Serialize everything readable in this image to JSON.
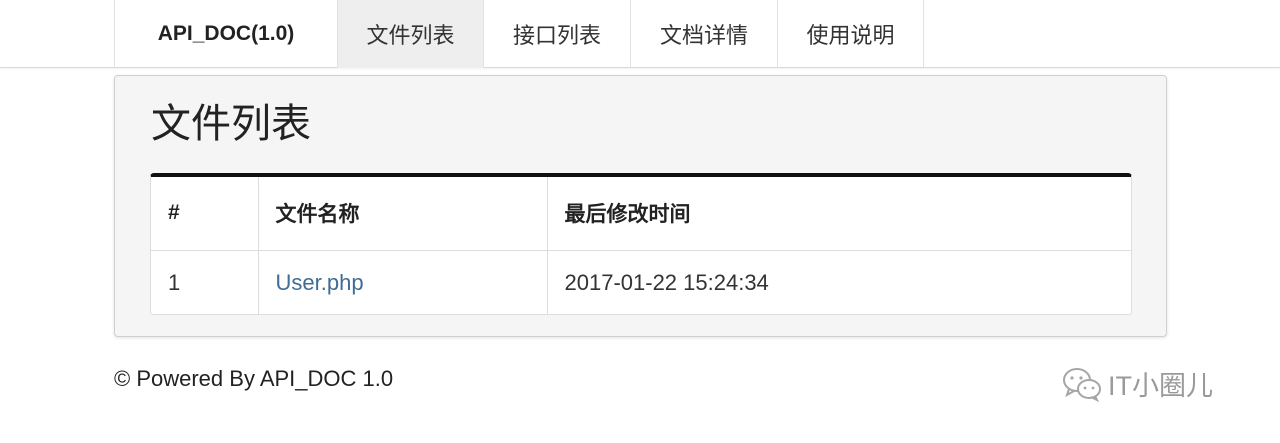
{
  "nav": {
    "brand": "API_DOC(1.0)",
    "items": [
      {
        "label": "文件列表",
        "active": true
      },
      {
        "label": "接口列表",
        "active": false
      },
      {
        "label": "文档详情",
        "active": false
      },
      {
        "label": "使用说明",
        "active": false
      }
    ]
  },
  "main": {
    "title": "文件列表",
    "table": {
      "headers": [
        "#",
        "文件名称",
        "最后修改时间"
      ],
      "rows": [
        {
          "index": "1",
          "filename": "User.php",
          "modified": "2017-01-22 15:24:34"
        }
      ]
    }
  },
  "footer": {
    "text": "© Powered By API_DOC 1.0"
  },
  "watermark": {
    "text": "IT小圈儿",
    "icon": "wechat-icon"
  },
  "colors": {
    "link": "#3f6d96",
    "active_nav_bg": "#eeeeee",
    "panel_bg": "#f5f5f5",
    "table_top_border": "#111111"
  }
}
